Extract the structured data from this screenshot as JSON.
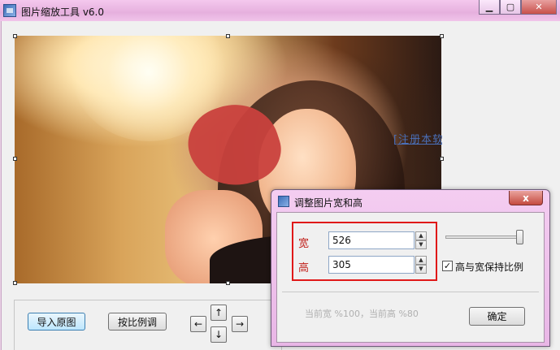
{
  "window": {
    "title": "图片缩放工具 v6.0",
    "minimize_icon": "minimize-icon",
    "maximize_icon": "maximize-icon",
    "close_icon": "close-icon"
  },
  "canvas": {
    "register_link": "[注册本软"
  },
  "toolbar": {
    "import_label": "导入原图",
    "scale_label": "按比例调",
    "arrow_up": "↑",
    "arrow_left": "←",
    "arrow_right": "→",
    "arrow_down": "↓"
  },
  "dialog": {
    "title": "调整图片宽和高",
    "close_glyph": "x",
    "width_label": "宽",
    "width_value": "526",
    "height_label": "高",
    "height_value": "305",
    "keep_ratio_label": "高与宽保持比例",
    "keep_ratio_checked": true,
    "status": "当前宽 %100，当前高 %80",
    "ok_label": "确定"
  },
  "colors": {
    "highlight_box": "#e01818",
    "field_label": "#c0201a",
    "link": "#4a6fb8",
    "titlebar": "#f0c4ea"
  }
}
